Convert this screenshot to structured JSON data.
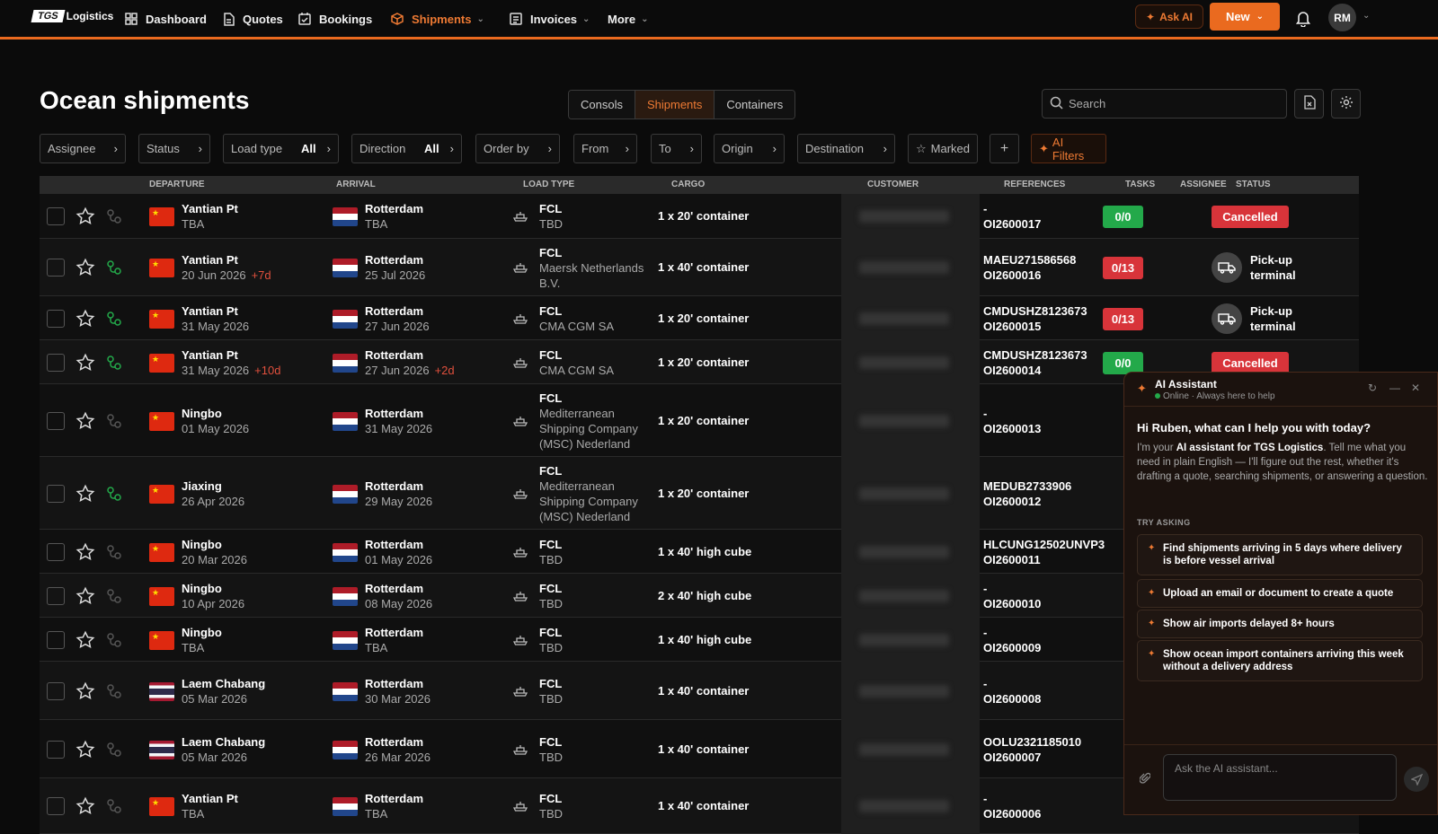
{
  "brand": {
    "logo_box": "TGS",
    "logo_text": "Logistics"
  },
  "nav": {
    "dashboard": "Dashboard",
    "quotes": "Quotes",
    "bookings": "Bookings",
    "shipments": "Shipments",
    "invoices": "Invoices",
    "more": "More"
  },
  "top_actions": {
    "ask_ai": "Ask AI",
    "new": "New",
    "avatar": "RM"
  },
  "page": {
    "title": "Ocean shipments"
  },
  "tabs": [
    "Consols",
    "Shipments",
    "Containers"
  ],
  "search": {
    "placeholder": "Search"
  },
  "filters": {
    "assignee": "Assignee",
    "status": "Status",
    "load_type": "Load type",
    "load_type_val": "All",
    "direction": "Direction",
    "direction_val": "All",
    "order_by": "Order by",
    "from": "From",
    "to": "To",
    "origin": "Origin",
    "destination": "Destination",
    "marked": "Marked",
    "ai_filters": "AI Filters"
  },
  "columns": {
    "departure": "DEPARTURE",
    "arrival": "ARRIVAL",
    "load_type": "LOAD TYPE",
    "cargo": "CARGO",
    "customer": "CUSTOMER",
    "references": "REFERENCES",
    "tasks": "TASKS",
    "assignee": "ASSIGNEE",
    "status": "STATUS"
  },
  "rows": [
    {
      "dep_city": "Yantian Pt",
      "dep_date": "TBA",
      "dep_delay": "",
      "arr_city": "Rotterdam",
      "arr_date": "TBA",
      "arr_delay": "",
      "load": "FCL",
      "carrier": "TBD",
      "cargo": "1 x 20' container",
      "ref1": "-",
      "ref2": "OI2600017",
      "tasks": "0/0",
      "status": "Cancelled"
    },
    {
      "dep_city": "Yantian Pt",
      "dep_date": "20 Jun 2026",
      "dep_delay": "+7d",
      "arr_city": "Rotterdam",
      "arr_date": "25 Jul 2026",
      "arr_delay": "",
      "load": "FCL",
      "carrier": "Maersk Netherlands B.V.",
      "cargo": "1 x 40' container",
      "ref1": "MAEU271586568",
      "ref2": "OI2600016",
      "tasks": "0/13",
      "status": "Pick-up terminal"
    },
    {
      "dep_city": "Yantian Pt",
      "dep_date": "31 May 2026",
      "dep_delay": "",
      "arr_city": "Rotterdam",
      "arr_date": "27 Jun 2026",
      "arr_delay": "",
      "load": "FCL",
      "carrier": "CMA CGM SA",
      "cargo": "1 x 20' container",
      "ref1": "CMDUSHZ8123673",
      "ref2": "OI2600015",
      "tasks": "0/13",
      "status": "Pick-up terminal"
    },
    {
      "dep_city": "Yantian Pt",
      "dep_date": "31 May 2026",
      "dep_delay": "+10d",
      "arr_city": "Rotterdam",
      "arr_date": "27 Jun 2026",
      "arr_delay": "+2d",
      "load": "FCL",
      "carrier": "CMA CGM SA",
      "cargo": "1 x 20' container",
      "ref1": "CMDUSHZ8123673",
      "ref2": "OI2600014",
      "tasks": "0/0",
      "status": "Cancelled"
    },
    {
      "dep_city": "Ningbo",
      "dep_date": "01 May 2026",
      "dep_delay": "",
      "arr_city": "Rotterdam",
      "arr_date": "31 May 2026",
      "arr_delay": "",
      "load": "FCL",
      "carrier": "Mediterranean Shipping Company (MSC) Nederland",
      "cargo": "1 x 20' container",
      "ref1": "-",
      "ref2": "OI2600013",
      "tasks": "",
      "status": ""
    },
    {
      "dep_city": "Jiaxing",
      "dep_date": "26 Apr 2026",
      "dep_delay": "",
      "arr_city": "Rotterdam",
      "arr_date": "29 May 2026",
      "arr_delay": "",
      "load": "FCL",
      "carrier": "Mediterranean Shipping Company (MSC) Nederland",
      "cargo": "1 x 20' container",
      "ref1": "MEDUB2733906",
      "ref2": "OI2600012",
      "tasks": "",
      "status": ""
    },
    {
      "dep_city": "Ningbo",
      "dep_date": "20 Mar 2026",
      "dep_delay": "",
      "arr_city": "Rotterdam",
      "arr_date": "01 May 2026",
      "arr_delay": "",
      "load": "FCL",
      "carrier": "TBD",
      "cargo": "1 x 40' high cube",
      "ref1": "HLCUNG12502UNVP3",
      "ref2": "OI2600011",
      "tasks": "",
      "status": ""
    },
    {
      "dep_city": "Ningbo",
      "dep_date": "10 Apr 2026",
      "dep_delay": "",
      "arr_city": "Rotterdam",
      "arr_date": "08 May 2026",
      "arr_delay": "",
      "load": "FCL",
      "carrier": "TBD",
      "cargo": "2 x 40' high cube",
      "ref1": "-",
      "ref2": "OI2600010",
      "tasks": "",
      "status": ""
    },
    {
      "dep_city": "Ningbo",
      "dep_date": "TBA",
      "dep_delay": "",
      "arr_city": "Rotterdam",
      "arr_date": "TBA",
      "arr_delay": "",
      "load": "FCL",
      "carrier": "TBD",
      "cargo": "1 x 40' high cube",
      "ref1": "-",
      "ref2": "OI2600009",
      "tasks": "",
      "status": ""
    },
    {
      "dep_city": "Laem Chabang",
      "dep_date": "05 Mar 2026",
      "dep_delay": "",
      "arr_city": "Rotterdam",
      "arr_date": "30 Mar 2026",
      "arr_delay": "",
      "load": "FCL",
      "carrier": "TBD",
      "cargo": "1 x 40' container",
      "ref1": "-",
      "ref2": "OI2600008",
      "tasks": "",
      "status": ""
    },
    {
      "dep_city": "Laem Chabang",
      "dep_date": "05 Mar 2026",
      "dep_delay": "",
      "arr_city": "Rotterdam",
      "arr_date": "26 Mar 2026",
      "arr_delay": "",
      "load": "FCL",
      "carrier": "TBD",
      "cargo": "1 x 40' container",
      "ref1": "OOLU2321185010",
      "ref2": "OI2600007",
      "tasks": "",
      "status": ""
    },
    {
      "dep_city": "Yantian Pt",
      "dep_date": "TBA",
      "dep_delay": "",
      "arr_city": "Rotterdam",
      "arr_date": "TBA",
      "arr_delay": "",
      "load": "FCL",
      "carrier": "TBD",
      "cargo": "1 x 40' container",
      "ref1": "-",
      "ref2": "OI2600006",
      "tasks": "",
      "status": ""
    }
  ],
  "ai": {
    "title": "AI Assistant",
    "subtitle": "Online · Always here to help",
    "greeting": "Hi Ruben, what can I help you with today?",
    "intro_pre": "I'm your ",
    "intro_bold": "AI assistant for TGS Logistics",
    "intro_post": ". Tell me what you need in plain English — I'll figure out the rest, whether it's drafting a quote, searching shipments, or answering a question.",
    "try_label": "TRY ASKING",
    "suggestions": [
      "Find shipments arriving in 5 days where delivery is before vessel arrival",
      "Upload an email or document to create a quote",
      "Show air imports delayed 8+ hours",
      "Show ocean import containers arriving this week without a delivery address"
    ],
    "input_placeholder": "Ask the AI assistant..."
  },
  "colors": {
    "accent": "#ea6a1f",
    "green": "#23a94a",
    "red": "#d8343a"
  }
}
